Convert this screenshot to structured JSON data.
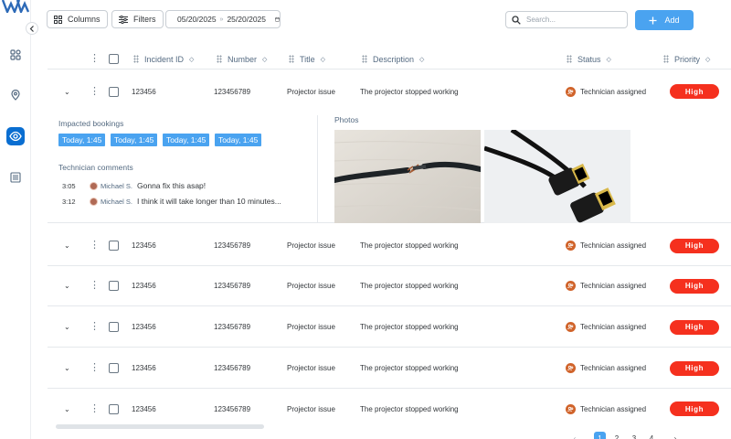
{
  "toolbar": {
    "columns_label": "Columns",
    "filters_label": "Filters",
    "date_from": "05/20/2025",
    "date_sep": "»",
    "date_to": "25/20/2025",
    "search_placeholder": "Search...",
    "add_label": "Add"
  },
  "table": {
    "headers": {
      "incident_id": "Incident ID",
      "number": "Number",
      "title": "Title",
      "description": "Description",
      "status": "Status",
      "priority": "Priority"
    },
    "rows": [
      {
        "incident_id": "123456",
        "number": "123456789",
        "title": "Projector issue",
        "description": "The projector stopped working",
        "status": "Technician assigned",
        "priority": "High"
      },
      {
        "incident_id": "123456",
        "number": "123456789",
        "title": "Projector issue",
        "description": "The projector stopped working",
        "status": "Technician assigned",
        "priority": "High"
      },
      {
        "incident_id": "123456",
        "number": "123456789",
        "title": "Projector issue",
        "description": "The projector stopped working",
        "status": "Technician assigned",
        "priority": "High"
      },
      {
        "incident_id": "123456",
        "number": "123456789",
        "title": "Projector issue",
        "description": "The projector stopped working",
        "status": "Technician assigned",
        "priority": "High"
      },
      {
        "incident_id": "123456",
        "number": "123456789",
        "title": "Projector issue",
        "description": "The projector stopped working",
        "status": "Technician assigned",
        "priority": "High"
      },
      {
        "incident_id": "123456",
        "number": "123456789",
        "title": "Projector issue",
        "description": "The projector stopped working",
        "status": "Technician assigned",
        "priority": "High"
      }
    ]
  },
  "expanded": {
    "bookings_title": "Impacted bookings",
    "bookings": [
      "Today, 1:45",
      "Today, 1:45",
      "Today, 1:45",
      "Today, 1:45"
    ],
    "comments_title": "Technician comments",
    "comments": [
      {
        "time": "3:05",
        "author": "Michael S.",
        "text": "Gonna fix this asap!"
      },
      {
        "time": "3:12",
        "author": "Michael S.",
        "text": "I think it will take longer than 10 minutes..."
      }
    ],
    "photos_title": "Photos"
  },
  "pagination": {
    "prev": "‹",
    "pages": [
      "1",
      "2",
      "3",
      "4"
    ],
    "next": "›",
    "current": "1"
  },
  "colors": {
    "accent": "#4aa3f0",
    "nav_active": "#0a6ed1",
    "priority_high": "#f5301e",
    "status_icon": "#d0632a"
  },
  "icons": {
    "columns": "grid-icon",
    "filters": "sliders-icon",
    "date": "calendar-icon",
    "search": "search-icon",
    "add": "plus-icon",
    "nav": [
      "apps-icon",
      "location-pin-icon",
      "eye-icon",
      "list-icon"
    ],
    "status": "technician-icon"
  }
}
